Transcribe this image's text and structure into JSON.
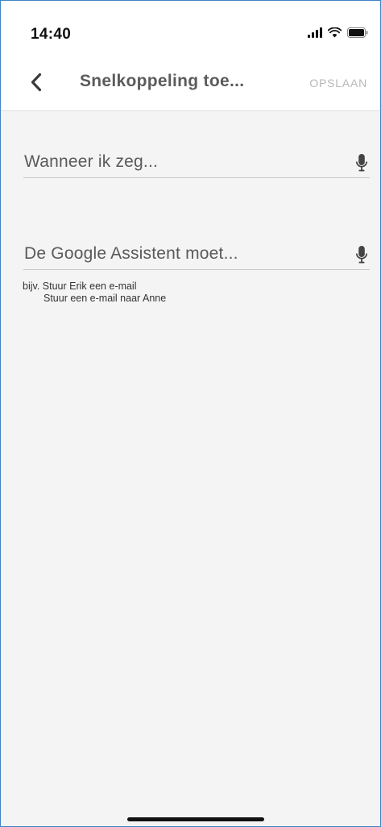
{
  "status_bar": {
    "time": "14:40"
  },
  "header": {
    "title": "Snelkoppeling toe...",
    "save_label": "OPSLAAN",
    "back_icon": "chevron-left-icon"
  },
  "fields": [
    {
      "placeholder": "Wanneer ik zeg...",
      "icon": "microphone-icon"
    },
    {
      "placeholder": "De Google Assistent moet...",
      "icon": "microphone-icon"
    }
  ],
  "hint": {
    "line1": "bijv. Stuur Erik een e-mail",
    "line2": "Stuur een e-mail naar Anne"
  },
  "colors": {
    "background": "#f4f4f4",
    "header_background": "#ffffff",
    "title": "#5b5b5b",
    "save_disabled": "#b8b8b8",
    "frame_border": "#3f83c6"
  }
}
